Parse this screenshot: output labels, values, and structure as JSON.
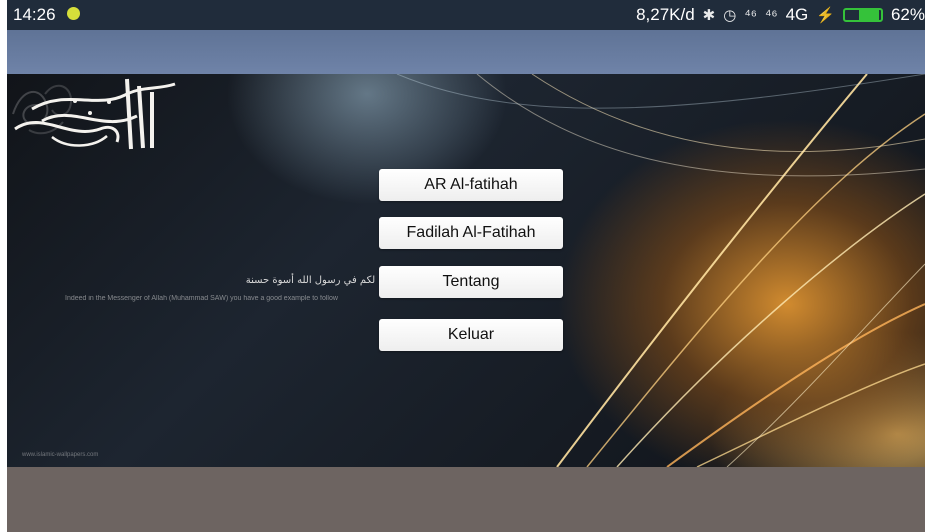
{
  "status_bar": {
    "time": "14:26",
    "network_speed": "8,27K/d",
    "network": "4G",
    "battery": "62%"
  },
  "menu": {
    "buttons": [
      {
        "label": "AR Al-fatihah"
      },
      {
        "label": "Fadilah Al-Fatihah"
      },
      {
        "label": "Tentang"
      },
      {
        "label": "Keluar"
      }
    ]
  },
  "background": {
    "arabic_caption": "لقد كان لكم في رسول الله أسوة حسنة",
    "english_caption": "Indeed in the Messenger of Allah (Muhammad SAW) you have a good example to follow",
    "signature": "www.islamic-wallpapers.com"
  },
  "colors": {
    "status_bar": "#202c3b",
    "app_bar": "#6a7fa4",
    "bottom_area": "#6d6461",
    "accent_gold": "#db9130"
  }
}
